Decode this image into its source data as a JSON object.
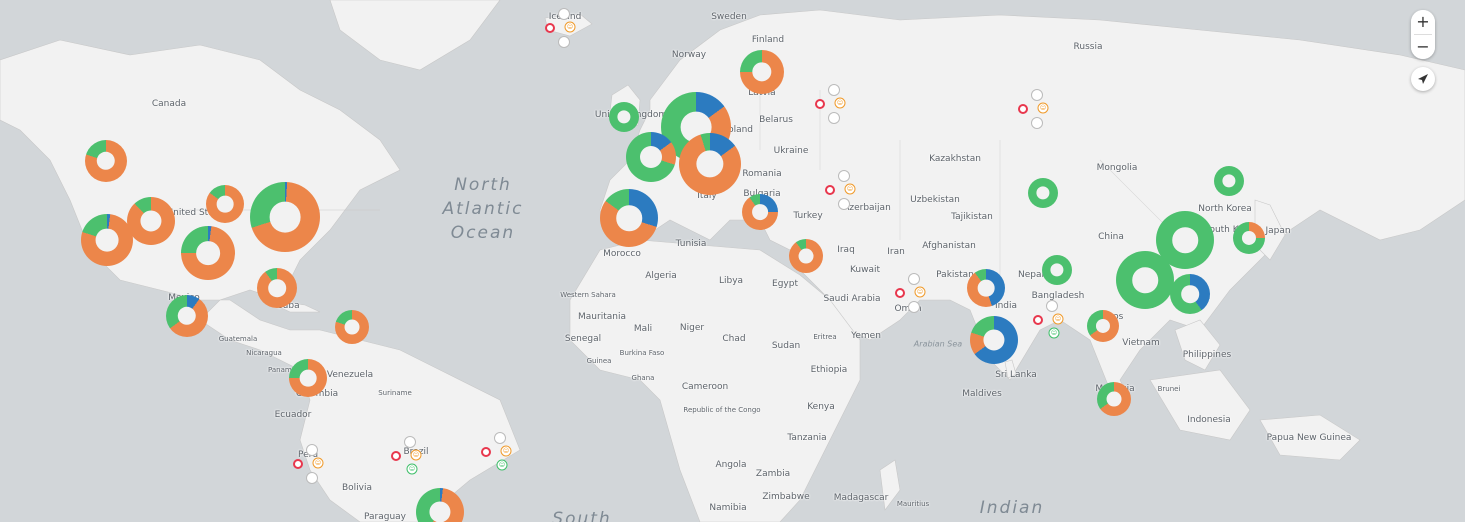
{
  "colors": {
    "water": "#d2d6d9",
    "land": "#f2f2f2",
    "border": "#c8c8c8",
    "green": "#4cc06e",
    "orange": "#ec864a",
    "blue": "#2c7bc0",
    "red": "#e8374d"
  },
  "controls": {
    "zoom_in": "+",
    "zoom_out": "−",
    "locate_icon": "navigation-arrow-icon"
  },
  "labels": [
    {
      "text": "Iceland",
      "kind": "country"
    },
    {
      "text": "Sweden",
      "kind": "country"
    },
    {
      "text": "Finland",
      "kind": "country"
    },
    {
      "text": "Norway",
      "kind": "country"
    },
    {
      "text": "Russia",
      "kind": "country"
    },
    {
      "text": "Canada",
      "kind": "country"
    },
    {
      "text": "Latvia",
      "kind": "country"
    },
    {
      "text": "United Kingdom",
      "kind": "country"
    },
    {
      "text": "Poland",
      "kind": "country"
    },
    {
      "text": "Belarus",
      "kind": "country"
    },
    {
      "text": "Ukraine",
      "kind": "country"
    },
    {
      "text": "France",
      "kind": "country"
    },
    {
      "text": "Austria",
      "kind": "country"
    },
    {
      "text": "Romania",
      "kind": "country"
    },
    {
      "text": "Bulgaria",
      "kind": "country"
    },
    {
      "text": "Italy",
      "kind": "country"
    },
    {
      "text": "Kazakhstan",
      "kind": "country"
    },
    {
      "text": "Mongolia",
      "kind": "country"
    },
    {
      "text": "Uzbekistan",
      "kind": "country"
    },
    {
      "text": "Tajikistan",
      "kind": "country"
    },
    {
      "text": "Azerbaijan",
      "kind": "country"
    },
    {
      "text": "Turkey",
      "kind": "country"
    },
    {
      "text": "North Korea",
      "kind": "country"
    },
    {
      "text": "South Korea",
      "kind": "country"
    },
    {
      "text": "Japan",
      "kind": "country"
    },
    {
      "text": "China",
      "kind": "country"
    },
    {
      "text": "Afghanistan",
      "kind": "country"
    },
    {
      "text": "Iran",
      "kind": "country"
    },
    {
      "text": "Iraq",
      "kind": "country"
    },
    {
      "text": "Kuwait",
      "kind": "country"
    },
    {
      "text": "Pakistan",
      "kind": "country"
    },
    {
      "text": "Nepal",
      "kind": "country"
    },
    {
      "text": "Bangladesh",
      "kind": "country"
    },
    {
      "text": "India",
      "kind": "country"
    },
    {
      "text": "Taiwan",
      "kind": "country"
    },
    {
      "text": "Laos",
      "kind": "country"
    },
    {
      "text": "Vietnam",
      "kind": "country"
    },
    {
      "text": "Philippines",
      "kind": "country"
    },
    {
      "text": "Saudi Arabia",
      "kind": "country"
    },
    {
      "text": "Oman",
      "kind": "country"
    },
    {
      "text": "Yemen",
      "kind": "country"
    },
    {
      "text": "Egypt",
      "kind": "country"
    },
    {
      "text": "Libya",
      "kind": "country"
    },
    {
      "text": "Tunisia",
      "kind": "country"
    },
    {
      "text": "Morocco",
      "kind": "country"
    },
    {
      "text": "Algeria",
      "kind": "country"
    },
    {
      "text": "Western Sahara",
      "kind": "small"
    },
    {
      "text": "Mauritania",
      "kind": "country"
    },
    {
      "text": "Mali",
      "kind": "country"
    },
    {
      "text": "Niger",
      "kind": "country"
    },
    {
      "text": "Chad",
      "kind": "country"
    },
    {
      "text": "Sudan",
      "kind": "country"
    },
    {
      "text": "Eritrea",
      "kind": "small"
    },
    {
      "text": "Ethiopia",
      "kind": "country"
    },
    {
      "text": "Senegal",
      "kind": "country"
    },
    {
      "text": "Guinea",
      "kind": "small"
    },
    {
      "text": "Burkina Faso",
      "kind": "small"
    },
    {
      "text": "Ghana",
      "kind": "small"
    },
    {
      "text": "Cameroon",
      "kind": "country"
    },
    {
      "text": "Republic of the Congo",
      "kind": "small"
    },
    {
      "text": "Kenya",
      "kind": "country"
    },
    {
      "text": "Tanzania",
      "kind": "country"
    },
    {
      "text": "Angola",
      "kind": "country"
    },
    {
      "text": "Zambia",
      "kind": "country"
    },
    {
      "text": "Zimbabwe",
      "kind": "country"
    },
    {
      "text": "Namibia",
      "kind": "country"
    },
    {
      "text": "Madagascar",
      "kind": "country"
    },
    {
      "text": "Mauritius",
      "kind": "small"
    },
    {
      "text": "Sri Lanka",
      "kind": "country"
    },
    {
      "text": "Maldives",
      "kind": "country"
    },
    {
      "text": "Malaysia",
      "kind": "country"
    },
    {
      "text": "Brunei",
      "kind": "small"
    },
    {
      "text": "Indonesia",
      "kind": "country"
    },
    {
      "text": "Papua New Guinea",
      "kind": "country"
    },
    {
      "text": "United States",
      "kind": "country"
    },
    {
      "text": "Mexico",
      "kind": "country"
    },
    {
      "text": "Cuba",
      "kind": "country"
    },
    {
      "text": "Guatemala",
      "kind": "small"
    },
    {
      "text": "Nicaragua",
      "kind": "small"
    },
    {
      "text": "Panama",
      "kind": "small"
    },
    {
      "text": "Venezuela",
      "kind": "country"
    },
    {
      "text": "Colombia",
      "kind": "country"
    },
    {
      "text": "Suriname",
      "kind": "small"
    },
    {
      "text": "Ecuador",
      "kind": "country"
    },
    {
      "text": "Peru",
      "kind": "country"
    },
    {
      "text": "Brazil",
      "kind": "country"
    },
    {
      "text": "Bolivia",
      "kind": "country"
    },
    {
      "text": "Paraguay",
      "kind": "country"
    },
    {
      "text": "North Atlantic Ocean",
      "kind": "ocean"
    },
    {
      "text": "Arabian Sea",
      "kind": "sea"
    },
    {
      "text": "Indian",
      "kind": "ocean"
    },
    {
      "text": "South",
      "kind": "ocean"
    }
  ],
  "clusters": [
    {
      "name": "cluster-iceland",
      "type": "spider"
    },
    {
      "name": "cluster-finland",
      "type": "donut",
      "shares": {
        "green": 0.25,
        "orange": 0.75,
        "blue": 0
      }
    },
    {
      "name": "cluster-moscow",
      "type": "spider"
    },
    {
      "name": "cluster-russia-east",
      "type": "spider"
    },
    {
      "name": "cluster-uk",
      "type": "donut",
      "shares": {
        "green": 1.0,
        "orange": 0,
        "blue": 0
      }
    },
    {
      "name": "cluster-germany",
      "type": "donut",
      "shares": {
        "green": 0.45,
        "orange": 0.4,
        "blue": 0.15
      }
    },
    {
      "name": "cluster-france",
      "type": "donut",
      "shares": {
        "green": 0.7,
        "orange": 0.15,
        "blue": 0.15
      }
    },
    {
      "name": "cluster-austria",
      "type": "donut",
      "shares": {
        "green": 0.05,
        "orange": 0.8,
        "blue": 0.15
      }
    },
    {
      "name": "cluster-spain",
      "type": "donut",
      "shares": {
        "green": 0.15,
        "orange": 0.55,
        "blue": 0.3
      }
    },
    {
      "name": "cluster-bulgaria",
      "type": "donut",
      "shares": {
        "green": 0.1,
        "orange": 0.65,
        "blue": 0.25
      }
    },
    {
      "name": "cluster-caucasus",
      "type": "spider"
    },
    {
      "name": "cluster-israel",
      "type": "donut",
      "shares": {
        "green": 0.1,
        "orange": 0.9,
        "blue": 0
      }
    },
    {
      "name": "cluster-kazakhstan",
      "type": "donut",
      "shares": {
        "green": 1.0,
        "orange": 0,
        "blue": 0
      }
    },
    {
      "name": "cluster-north-china",
      "type": "donut",
      "shares": {
        "green": 1.0,
        "orange": 0,
        "blue": 0
      }
    },
    {
      "name": "cluster-korea",
      "type": "donut",
      "shares": {
        "green": 0.75,
        "orange": 0.25,
        "blue": 0
      }
    },
    {
      "name": "cluster-east-china",
      "type": "donut",
      "shares": {
        "green": 1.0,
        "orange": 0,
        "blue": 0
      }
    },
    {
      "name": "cluster-south-china",
      "type": "donut",
      "shares": {
        "green": 1.0,
        "orange": 0,
        "blue": 0
      }
    },
    {
      "name": "cluster-taiwan",
      "type": "donut",
      "shares": {
        "green": 0.6,
        "orange": 0,
        "blue": 0.4
      }
    },
    {
      "name": "cluster-nepal",
      "type": "donut",
      "shares": {
        "green": 1.0,
        "orange": 0,
        "blue": 0
      }
    },
    {
      "name": "cluster-pakistan",
      "type": "donut",
      "shares": {
        "green": 0.1,
        "orange": 0.45,
        "blue": 0.45
      }
    },
    {
      "name": "cluster-india-south",
      "type": "donut",
      "shares": {
        "green": 0.2,
        "orange": 0.15,
        "blue": 0.65
      }
    },
    {
      "name": "cluster-thailand",
      "type": "donut",
      "shares": {
        "green": 0.35,
        "orange": 0.65,
        "blue": 0
      }
    },
    {
      "name": "cluster-malaysia",
      "type": "donut",
      "shares": {
        "green": 0.35,
        "orange": 0.65,
        "blue": 0
      }
    },
    {
      "name": "cluster-oman",
      "type": "spider"
    },
    {
      "name": "cluster-bangladesh",
      "type": "spider"
    },
    {
      "name": "cluster-us-northwest",
      "type": "donut",
      "shares": {
        "green": 0.2,
        "orange": 0.8,
        "blue": 0
      }
    },
    {
      "name": "cluster-us-california",
      "type": "donut",
      "shares": {
        "green": 0.2,
        "orange": 0.78,
        "blue": 0.02
      }
    },
    {
      "name": "cluster-us-mountain",
      "type": "donut",
      "shares": {
        "green": 0.12,
        "orange": 0.88,
        "blue": 0
      }
    },
    {
      "name": "cluster-us-midwest",
      "type": "donut",
      "shares": {
        "green": 0.15,
        "orange": 0.85,
        "blue": 0
      }
    },
    {
      "name": "cluster-us-texas",
      "type": "donut",
      "shares": {
        "green": 0.25,
        "orange": 0.73,
        "blue": 0.02
      }
    },
    {
      "name": "cluster-us-east",
      "type": "donut",
      "shares": {
        "green": 0.3,
        "orange": 0.69,
        "blue": 0.01
      }
    },
    {
      "name": "cluster-florida",
      "type": "donut",
      "shares": {
        "green": 0.1,
        "orange": 0.9,
        "blue": 0
      }
    },
    {
      "name": "cluster-mexico",
      "type": "donut",
      "shares": {
        "green": 0.35,
        "orange": 0.55,
        "blue": 0.1
      }
    },
    {
      "name": "cluster-caribbean",
      "type": "donut",
      "shares": {
        "green": 0.2,
        "orange": 0.8,
        "blue": 0
      }
    },
    {
      "name": "cluster-colombia",
      "type": "donut",
      "shares": {
        "green": 0.25,
        "orange": 0.75,
        "blue": 0
      }
    },
    {
      "name": "cluster-peru",
      "type": "spider"
    },
    {
      "name": "cluster-brazil-west",
      "type": "spider"
    },
    {
      "name": "cluster-brazil-east",
      "type": "spider"
    },
    {
      "name": "cluster-paraguay",
      "type": "donut",
      "shares": {
        "green": 0.4,
        "orange": 0.58,
        "blue": 0.02
      }
    }
  ]
}
